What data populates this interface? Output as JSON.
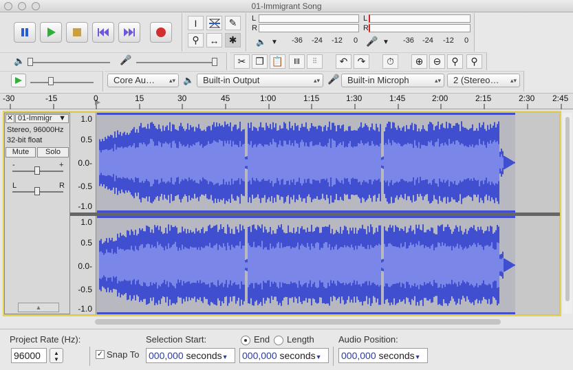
{
  "window": {
    "title": "01-Immigrant Song"
  },
  "meters": {
    "playback_channels": [
      "L",
      "R"
    ],
    "record_channels": [
      "L",
      "R"
    ],
    "scale": [
      "-36",
      "-24",
      "-12",
      "0"
    ]
  },
  "devices": {
    "host": "Core Au…",
    "output": "Built-in Output",
    "input": "Built-in Microph",
    "channels": "2 (Stereo…"
  },
  "ruler": {
    "ticks": [
      "-30",
      "-15",
      "0",
      "15",
      "30",
      "45",
      "1:00",
      "1:15",
      "1:30",
      "1:45",
      "2:00",
      "2:15",
      "2:30",
      "2:45"
    ]
  },
  "track": {
    "name": "01-Immigr",
    "info1": "Stereo, 96000Hz",
    "info2": "32-bit float",
    "mute": "Mute",
    "solo": "Solo",
    "gain_min": "-",
    "gain_max": "+",
    "pan_left": "L",
    "pan_right": "R",
    "y_labels": [
      "1.0",
      "0.5",
      "0.0-",
      "-0.5",
      "-1.0"
    ]
  },
  "status": {
    "rate_label": "Project Rate (Hz):",
    "rate_value": "96000",
    "snap_label": "Snap To",
    "selection_start_label": "Selection Start:",
    "end_label": "End",
    "length_label": "Length",
    "audio_position_label": "Audio Position:",
    "time_digits": "000,000",
    "time_unit": "seconds",
    "end_selected": true,
    "snap_checked": true
  },
  "colors": {
    "waveform": "#3f4fd0",
    "waveform_rms": "#7a86e8",
    "background": "#c8c8c8"
  }
}
